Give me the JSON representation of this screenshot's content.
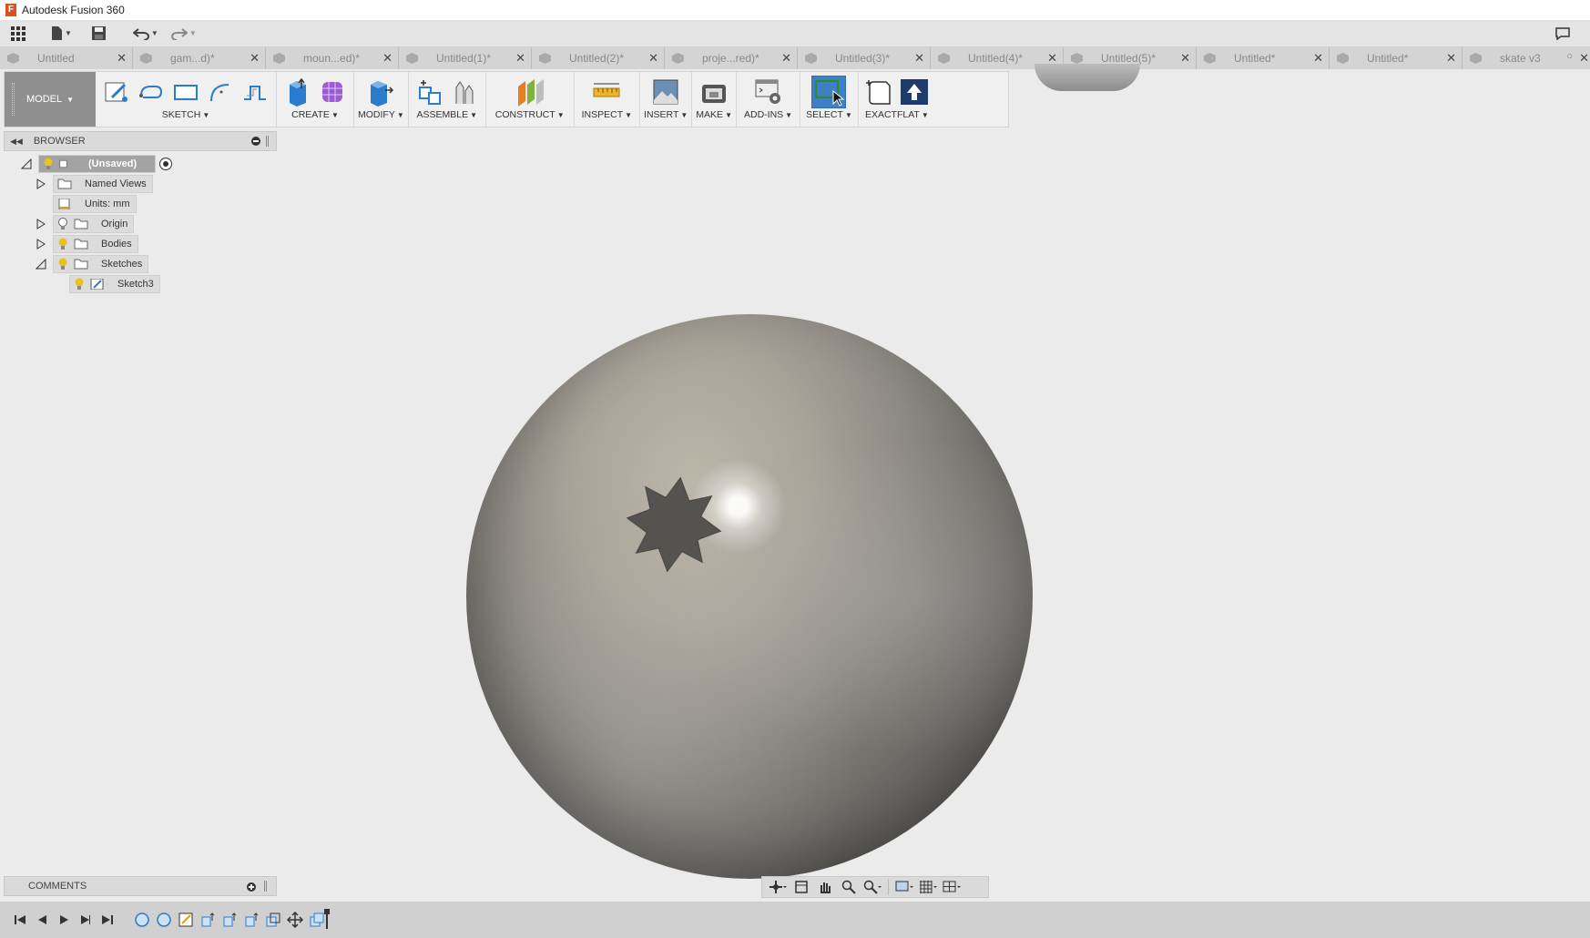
{
  "window": {
    "title": "Autodesk Fusion 360"
  },
  "tabs": [
    {
      "label": "Untitled"
    },
    {
      "label": "gam...d)*"
    },
    {
      "label": "moun...ed)*"
    },
    {
      "label": "Untitled(1)*"
    },
    {
      "label": "Untitled(2)*"
    },
    {
      "label": "proje...red)*"
    },
    {
      "label": "Untitled(3)*"
    },
    {
      "label": "Untitled(4)*"
    },
    {
      "label": "Untitled(5)*"
    },
    {
      "label": "Untitled*"
    },
    {
      "label": "Untitled*"
    },
    {
      "label": "skate v3"
    }
  ],
  "toolbar": {
    "workspace": "MODEL",
    "groups": {
      "sketch": "SKETCH",
      "create": "CREATE",
      "modify": "MODIFY",
      "assemble": "ASSEMBLE",
      "construct": "CONSTRUCT",
      "inspect": "INSPECT",
      "insert": "INSERT",
      "make": "MAKE",
      "addins": "ADD-INS",
      "select": "SELECT",
      "exactflat": "EXACTFLAT"
    }
  },
  "browser": {
    "title": "BROWSER",
    "root": "(Unsaved)",
    "items": {
      "named_views": "Named Views",
      "units": "Units: mm",
      "origin": "Origin",
      "bodies": "Bodies",
      "sketches": "Sketches",
      "sketch3": "Sketch3"
    }
  },
  "comments": {
    "title": "COMMENTS"
  },
  "colors": {
    "accent_select": "#2e6fb7",
    "workspace_bg": "#8f8f8f",
    "bulb": "#e9c21b"
  }
}
